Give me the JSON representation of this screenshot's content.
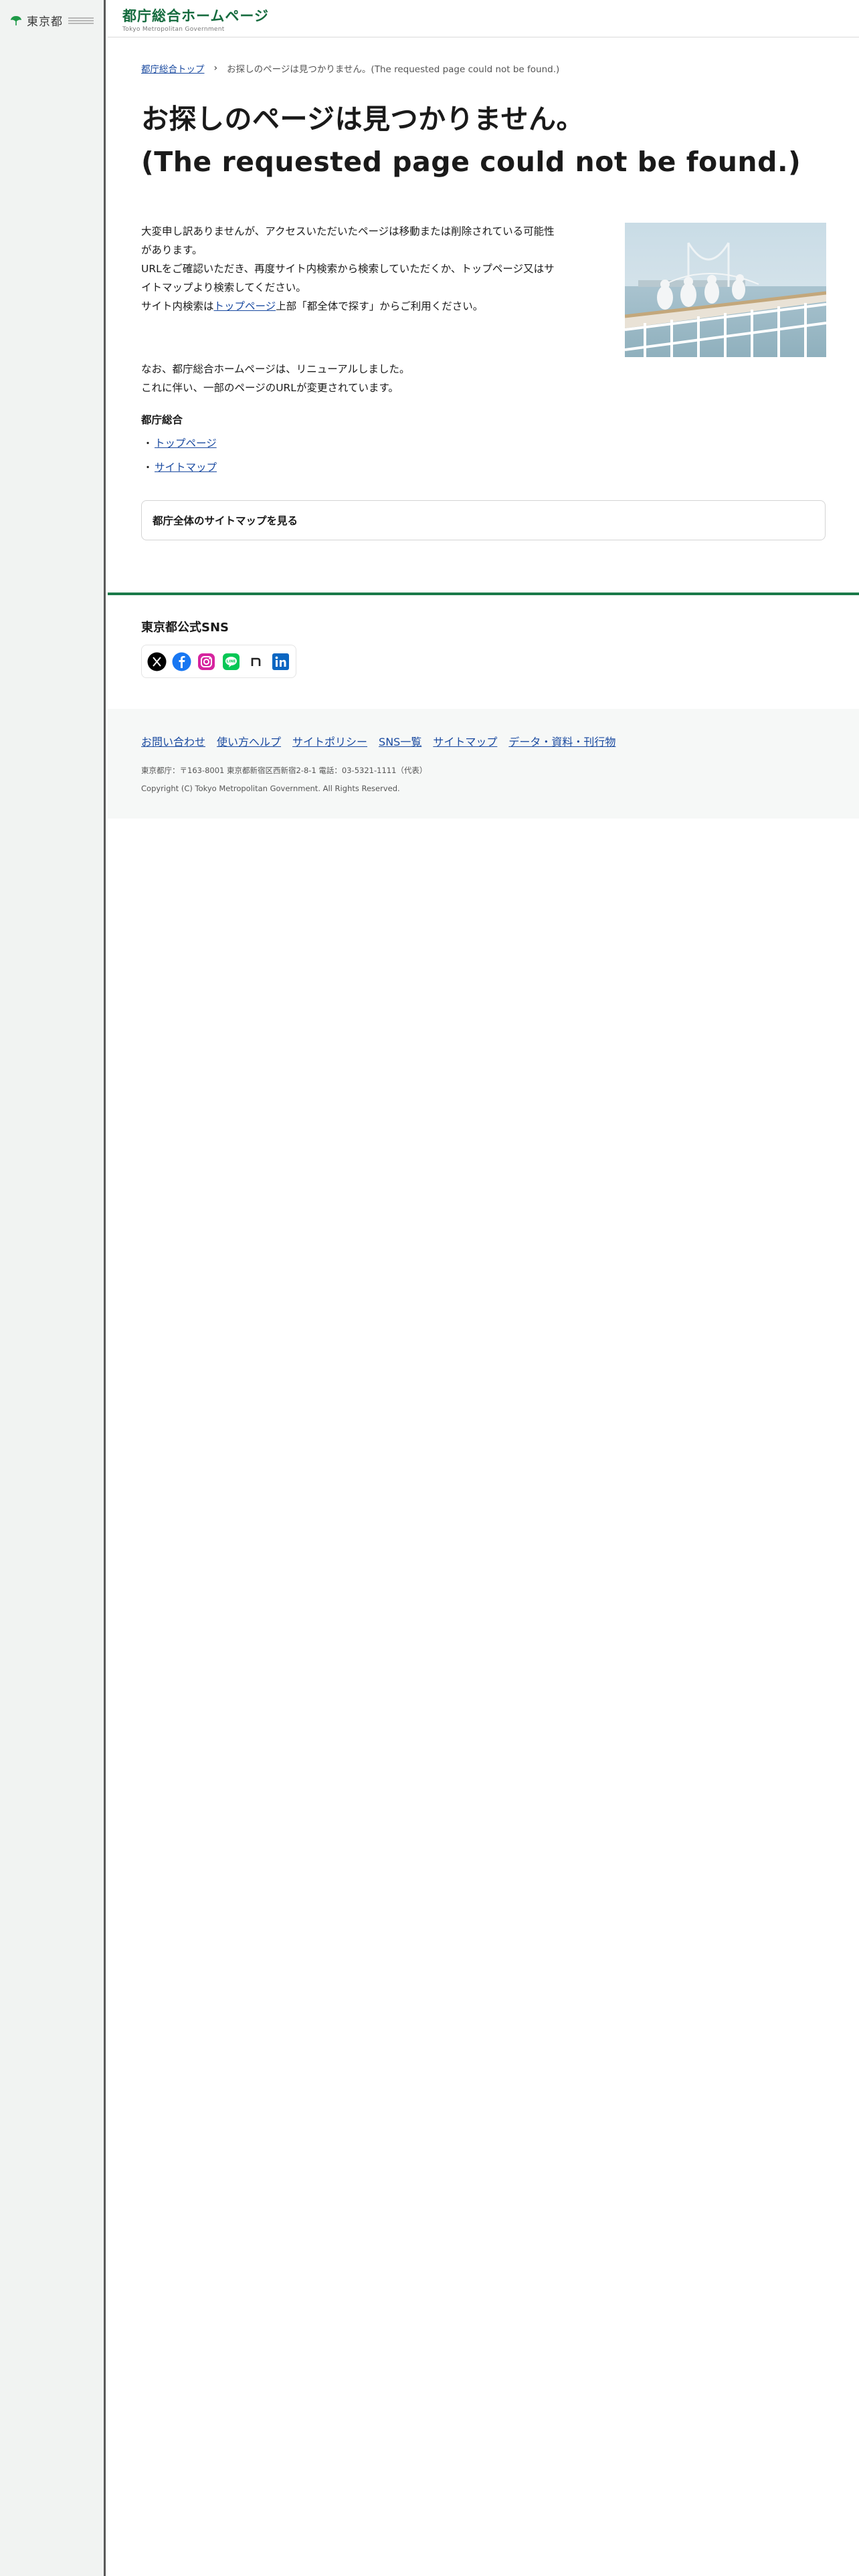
{
  "sidebar": {
    "logo_text": "東京都"
  },
  "header": {
    "title": "都庁総合ホームページ",
    "subtitle": "Tokyo Metropolitan Government"
  },
  "breadcrumb": {
    "home": "都庁総合トップ",
    "current": "お探しのページは見つかりません。(The requested page could not be found.)"
  },
  "page": {
    "title_ja": "お探しのページは見つかりません。",
    "title_en": "(The requested page could not be found.)",
    "paragraph_1_line_1": "大変申し訳ありませんが、アクセスいただいたページは移動または削除されている可能性",
    "paragraph_1_line_2": "があります。",
    "paragraph_1_line_3": "URLをご確認いただき、再度サイト内検索から検索していただくか、トップページ又はサ",
    "paragraph_1_line_4": "イトマップより検索してください。",
    "paragraph_1_line_5_pre": "サイト内検索は",
    "paragraph_1_line_5_link": "トップページ",
    "paragraph_1_line_5_post": "上部「都全体で探す」からご利用ください。",
    "note_line_1": "なお、都庁総合ホームページは、リニューアルしました。",
    "note_line_2": "これに伴い、一部のページのURLが変更されています。",
    "links_heading": "都庁総合",
    "links": [
      {
        "label": "トップページ"
      },
      {
        "label": "サイトマップ"
      }
    ],
    "sitemap_button": "都庁全体のサイトマップを見る"
  },
  "sns": {
    "heading": "東京都公式SNS",
    "icons": [
      {
        "name": "x-icon",
        "color": "#000000"
      },
      {
        "name": "facebook-icon",
        "color": "#1877f2"
      },
      {
        "name": "instagram-icon",
        "color": "#d6249f"
      },
      {
        "name": "line-icon",
        "color": "#06c755"
      },
      {
        "name": "note-icon",
        "color": "#222222"
      },
      {
        "name": "linkedin-icon",
        "color": "#0a66c2"
      }
    ]
  },
  "footer": {
    "links": [
      "お問い合わせ",
      "使い方ヘルプ",
      "サイトポリシー",
      "SNS一覧",
      "サイトマップ",
      "データ・資料・刊行物"
    ],
    "address": "東京都庁：〒163-8001 東京都新宿区西新宿2-8-1 電話：03-5321-1111（代表）",
    "copyright": "Copyright (C) Tokyo Metropolitan Government. All Rights Reserved."
  },
  "colors": {
    "brand_green": "#156b3e",
    "rule_green": "#1a7a49",
    "link_blue": "#1a4aa0",
    "sidebar_bg": "#f1f3f2"
  }
}
